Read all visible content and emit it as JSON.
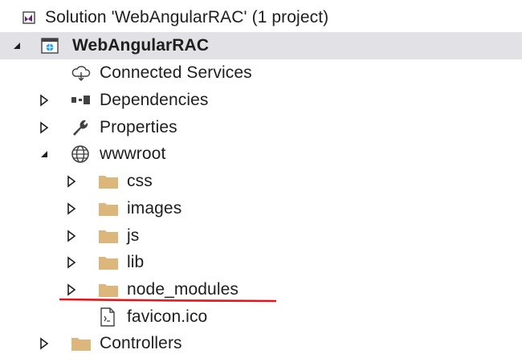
{
  "solution_explorer": {
    "solution": {
      "label": "Solution 'WebAngularRAC' (1 project)",
      "icon": "vs-solution-icon"
    },
    "project": {
      "label": "WebAngularRAC",
      "icon": "web-project-icon",
      "expanded": true,
      "selected": true
    },
    "items": [
      {
        "label": "Connected Services",
        "icon": "cloud-services-icon"
      },
      {
        "label": "Dependencies",
        "icon": "dependencies-icon",
        "expandable": true
      },
      {
        "label": "Properties",
        "icon": "wrench-icon",
        "expandable": true
      },
      {
        "label": "wwwroot",
        "icon": "globe-icon",
        "expanded": true,
        "children": [
          {
            "label": "css",
            "icon": "folder-icon"
          },
          {
            "label": "images",
            "icon": "folder-icon"
          },
          {
            "label": "js",
            "icon": "folder-icon"
          },
          {
            "label": "lib",
            "icon": "folder-icon"
          },
          {
            "label": "node_modules",
            "icon": "folder-icon",
            "highlighted": true
          },
          {
            "label": "favicon.ico",
            "icon": "file-icon"
          }
        ]
      },
      {
        "label": "Controllers",
        "icon": "folder-icon",
        "expandable": true
      }
    ]
  },
  "colors": {
    "selection": "#e1e1e6",
    "folder": "#dcb67a",
    "annotation_underline": "#e2151b",
    "vs_purple": "#68217a"
  }
}
